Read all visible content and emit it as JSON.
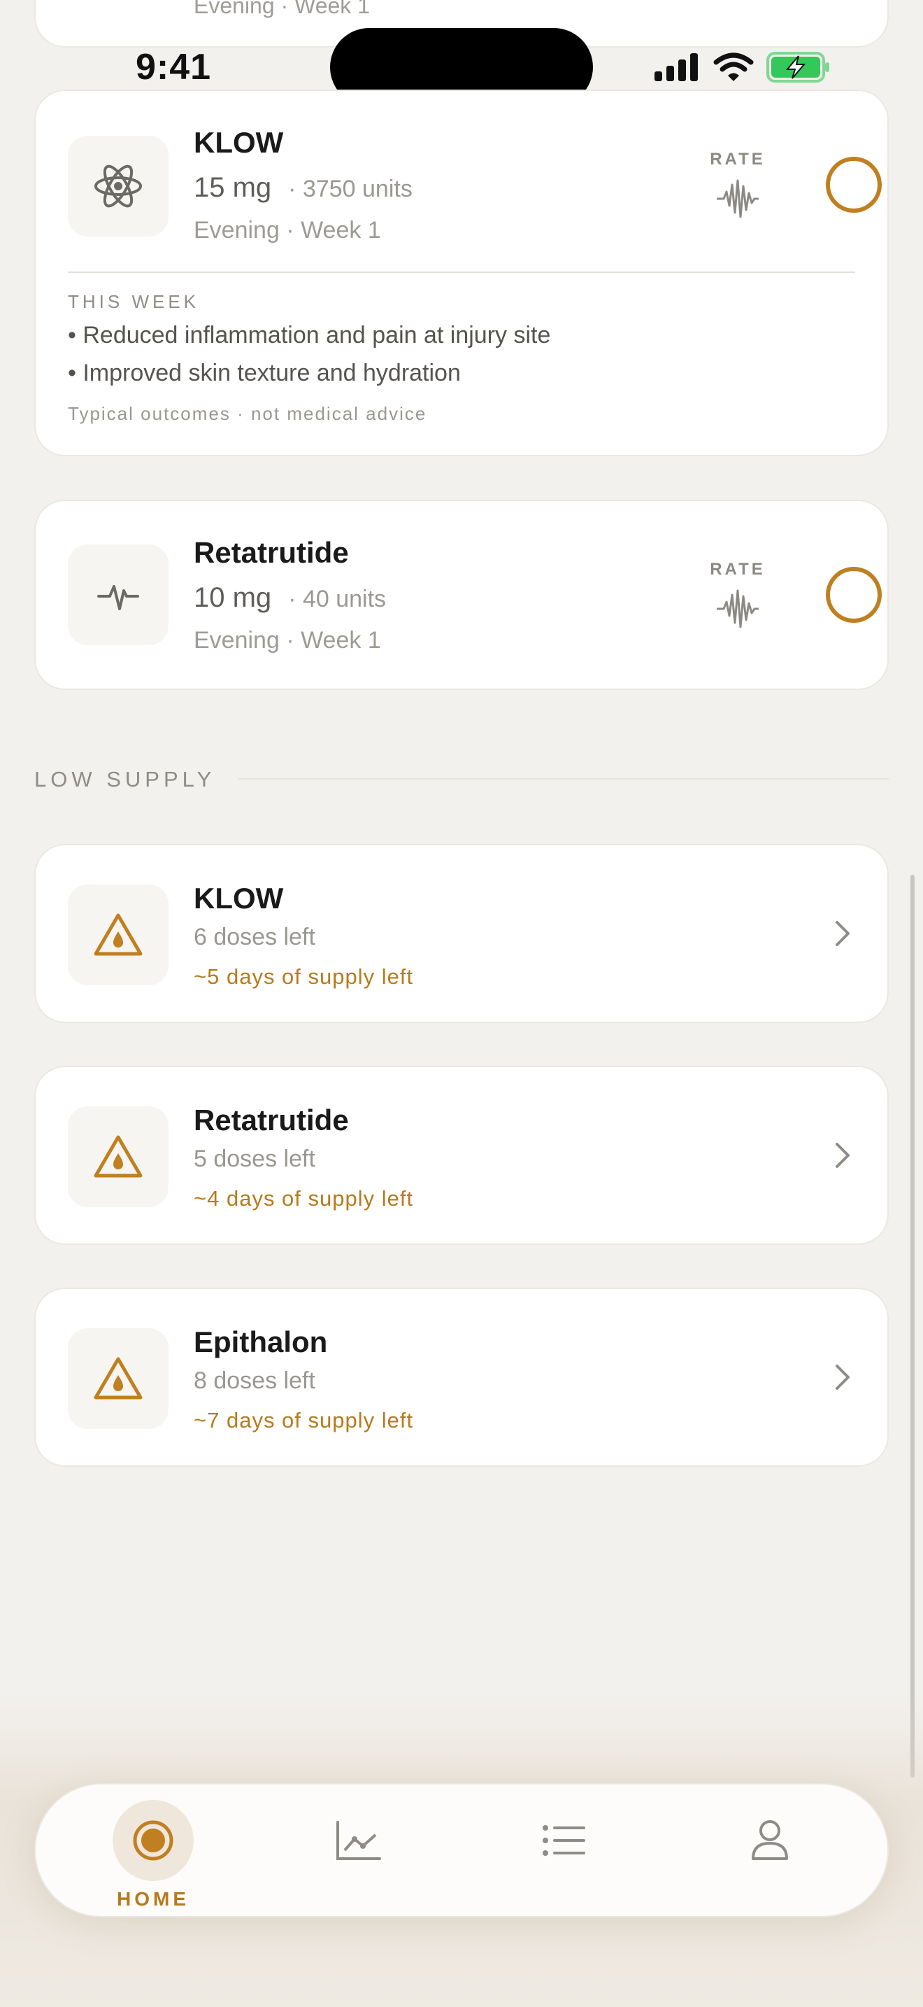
{
  "status": {
    "time": "9:41"
  },
  "partial_card": {
    "meta": "Evening · Week 1"
  },
  "doses": [
    {
      "name": "KLOW",
      "amount": "15 mg",
      "units": "· 3750 units",
      "meta": "Evening · Week 1",
      "rate_label": "RATE",
      "icon": "atom-icon",
      "this_week": {
        "label": "THIS WEEK",
        "items": [
          "• Reduced inflammation and pain at injury site",
          "• Improved skin texture and hydration"
        ],
        "disclaimer": "Typical outcomes · not medical advice"
      }
    },
    {
      "name": "Retatrutide",
      "amount": "10 mg",
      "units": "· 40 units",
      "meta": "Evening · Week 1",
      "rate_label": "RATE",
      "icon": "pulse-icon"
    }
  ],
  "low_supply": {
    "heading": "LOW SUPPLY",
    "items": [
      {
        "name": "KLOW",
        "doses_left": "6 doses left",
        "days_left": "~5 days of supply left"
      },
      {
        "name": "Retatrutide",
        "doses_left": "5 doses left",
        "days_left": "~4 days of supply left"
      },
      {
        "name": "Epithalon",
        "doses_left": "8 doses left",
        "days_left": "~7 days of supply left"
      }
    ]
  },
  "tabs": [
    {
      "label": "HOME",
      "icon": "home-target-icon",
      "active": true
    },
    {
      "label": "",
      "icon": "chart-icon",
      "active": false
    },
    {
      "label": "",
      "icon": "list-icon",
      "active": false
    },
    {
      "label": "",
      "icon": "profile-icon",
      "active": false
    }
  ],
  "colors": {
    "accent": "#c07f20",
    "background": "#f3f1ed",
    "card": "#ffffff"
  }
}
